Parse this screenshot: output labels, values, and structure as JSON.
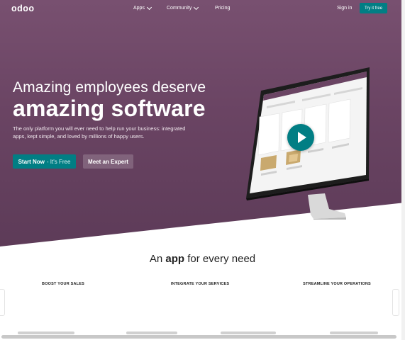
{
  "nav": {
    "logo": "odoo",
    "apps_label": "Apps",
    "community_label": "Community",
    "pricing_label": "Pricing",
    "signin_label": "Sign in",
    "try_label": "Try it free"
  },
  "hero": {
    "headline_line1": "Amazing employees deserve",
    "headline_line2": "amazing software",
    "subtitle": "The only platform you will ever need to help run your business: integrated apps, kept simple, and loved by millions of happy users.",
    "primary_button": "Start Now",
    "primary_button_suffix": "- It's Free",
    "secondary_button": "Meet an Expert"
  },
  "apps_section": {
    "title_prefix": "An",
    "title_bold": "app",
    "title_suffix": "for every need",
    "columns": [
      "BOOST YOUR SALES",
      "INTEGRATE YOUR SERVICES",
      "STREAMLINE YOUR OPERATIONS"
    ]
  },
  "colors": {
    "hero_purple": "#6a4463",
    "accent_teal": "#017e84"
  }
}
